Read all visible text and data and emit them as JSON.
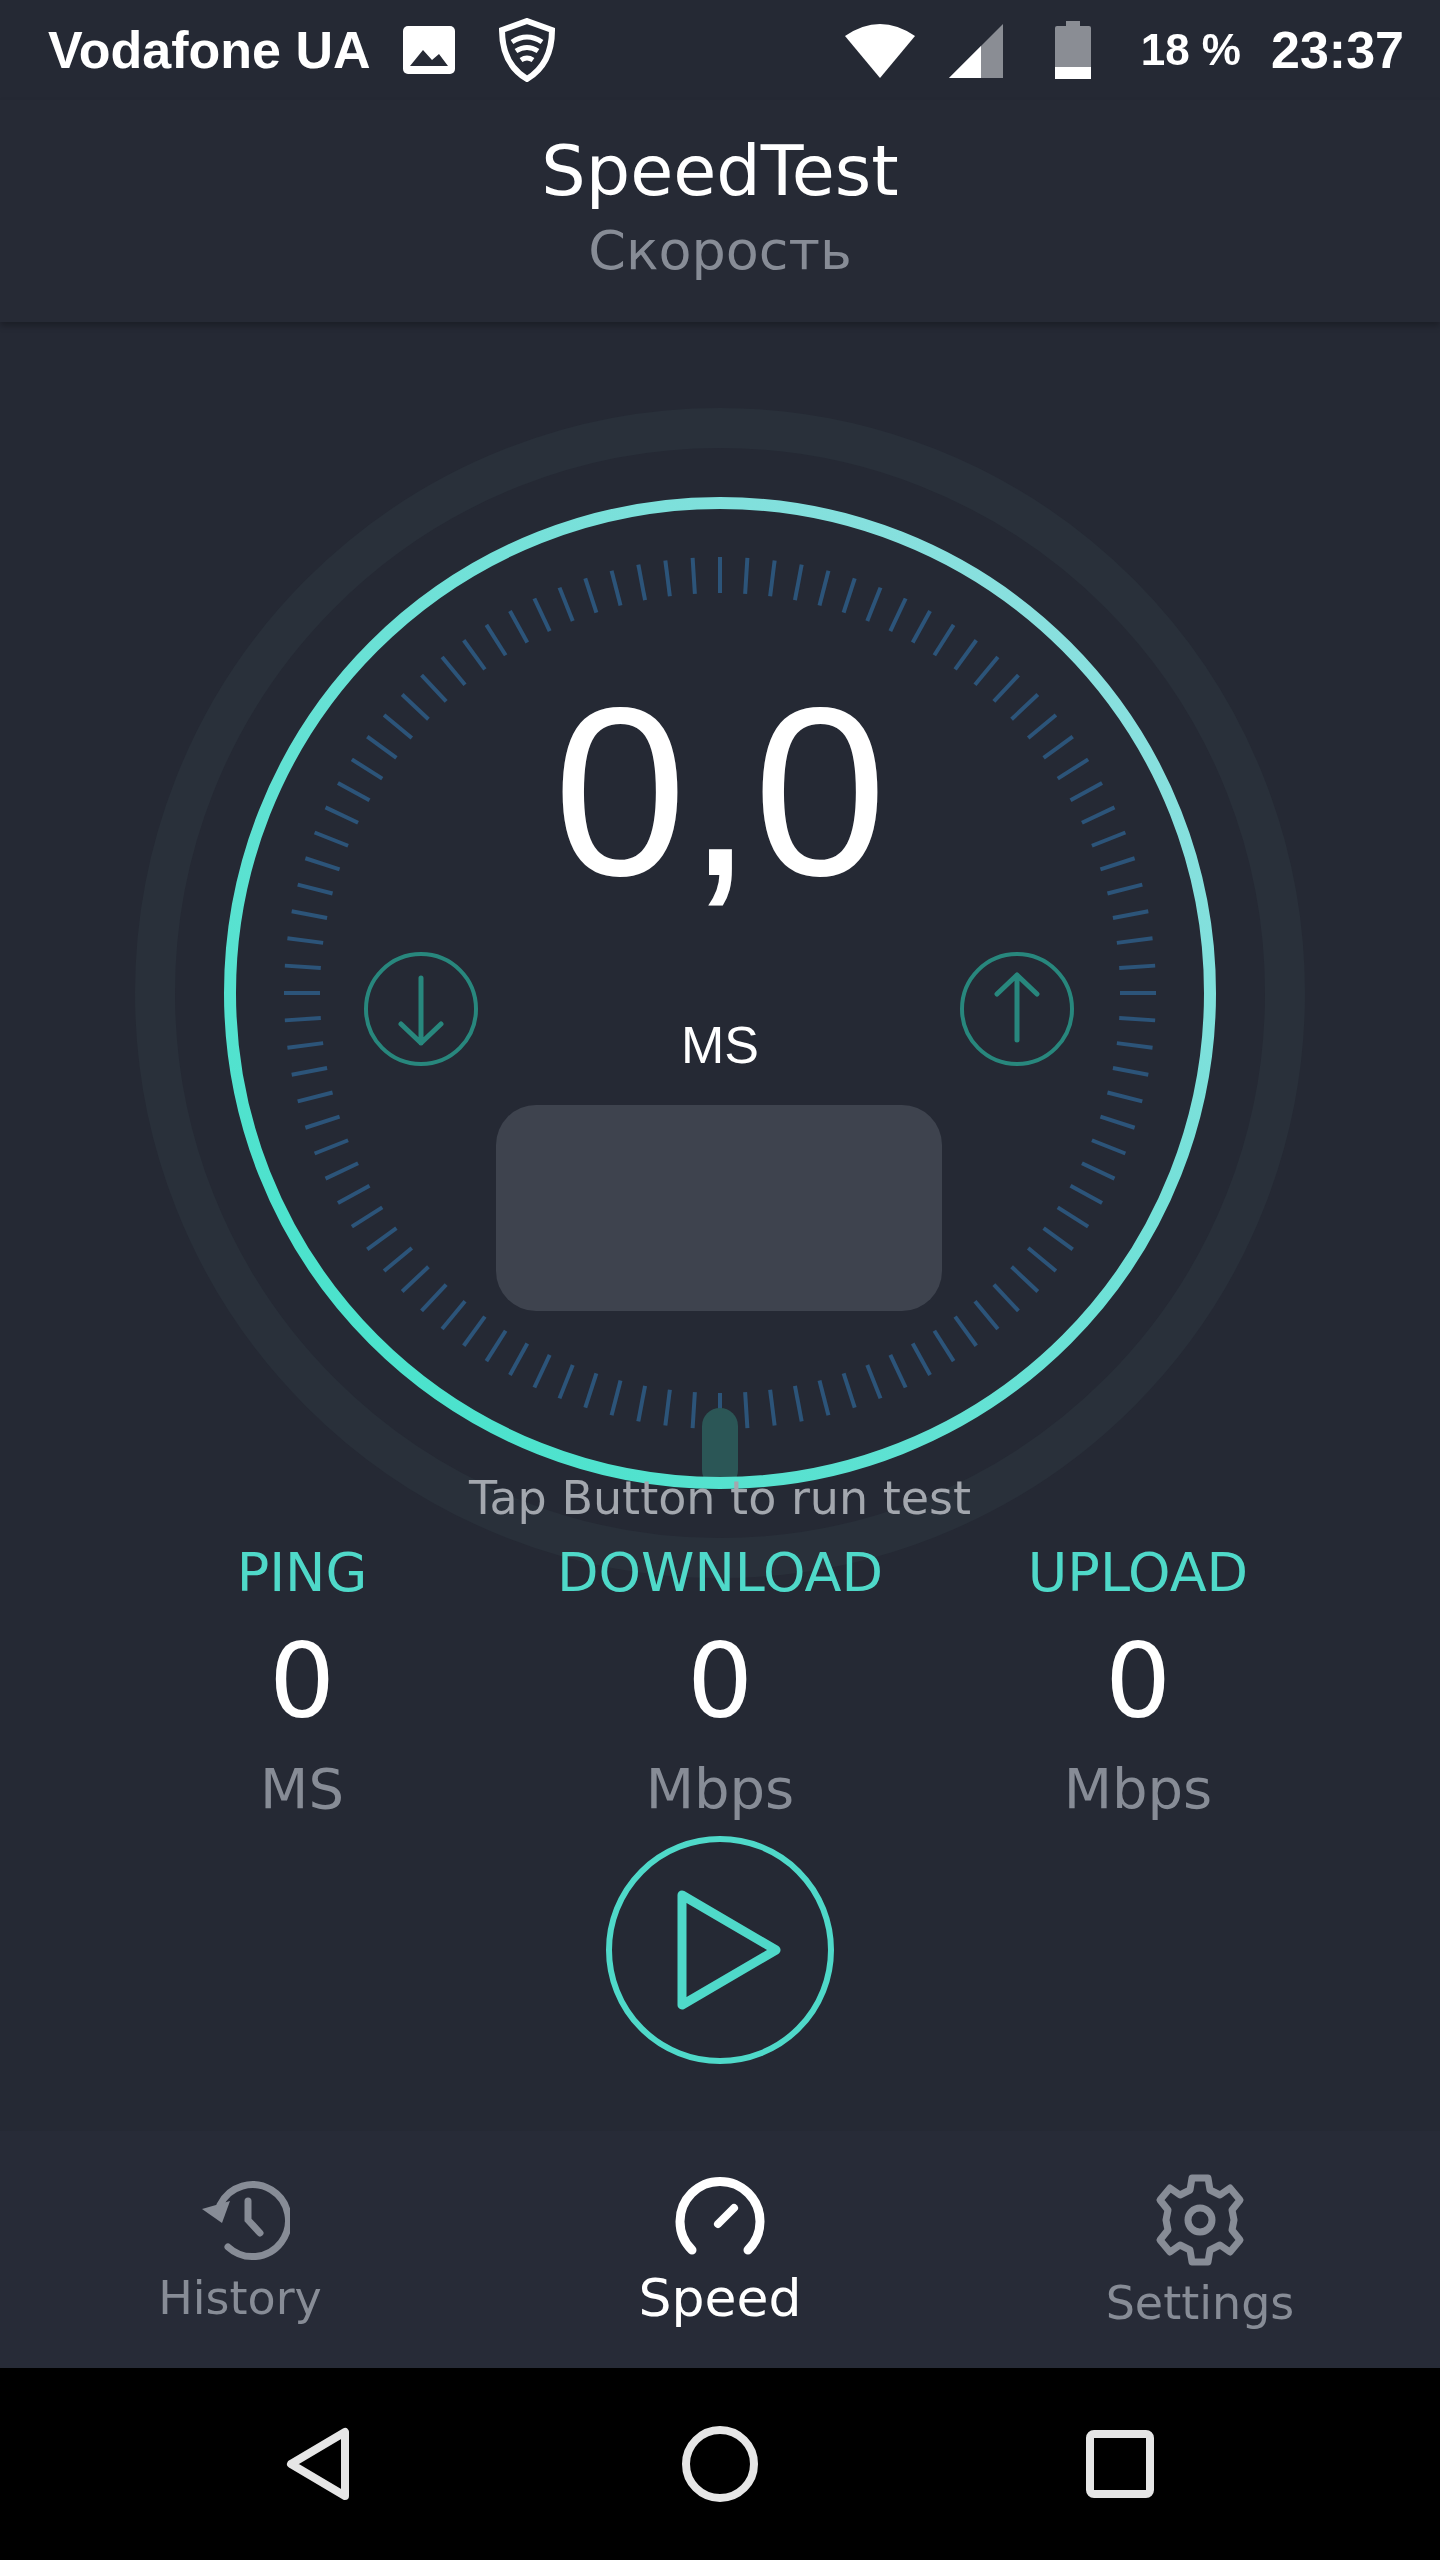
{
  "status_bar": {
    "carrier": "Vodafone UA",
    "battery": "18 %",
    "time": "23:37"
  },
  "app_bar": {
    "title": "SpeedTest",
    "subtitle": "Скорость"
  },
  "gauge": {
    "value": "0,0",
    "unit": "MS"
  },
  "hint": "Tap Button to run test",
  "stats": [
    {
      "label": "PING",
      "value": "0",
      "unit": "MS"
    },
    {
      "label": "DOWNLOAD",
      "value": "0",
      "unit": "Mbps"
    },
    {
      "label": "UPLOAD",
      "value": "0",
      "unit": "Mbps"
    }
  ],
  "bottom_nav": [
    {
      "kind": "history",
      "label": "History",
      "selected": false
    },
    {
      "kind": "speed",
      "label": "Speed",
      "selected": true
    },
    {
      "kind": "settings",
      "label": "Settings",
      "selected": false
    }
  ]
}
